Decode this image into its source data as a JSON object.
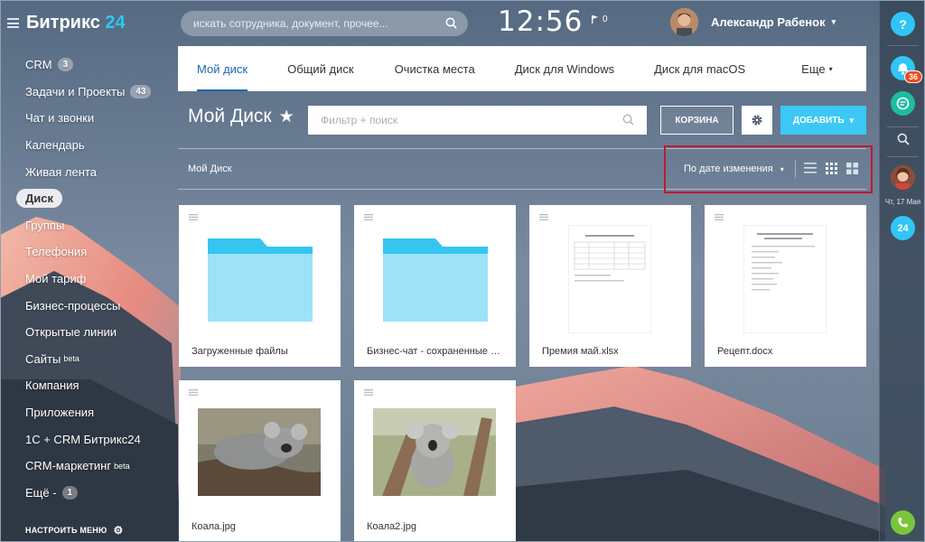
{
  "logo": {
    "text": "Битрикс",
    "number": "24"
  },
  "sidebar": {
    "items": [
      {
        "label": "CRM",
        "counter": "3"
      },
      {
        "label": "Задачи и Проекты",
        "counter": "43"
      },
      {
        "label": "Чат и звонки"
      },
      {
        "label": "Календарь"
      },
      {
        "label": "Живая лента"
      },
      {
        "label": "Диск",
        "active": true
      },
      {
        "label": "Группы"
      },
      {
        "label": "Телефония"
      },
      {
        "label": "Мой тариф"
      },
      {
        "label": "Бизнес-процессы"
      },
      {
        "label": "Открытые линии"
      },
      {
        "label": "Сайты",
        "beta": "beta"
      },
      {
        "label": "Компания"
      },
      {
        "label": "Приложения"
      },
      {
        "label": "1С + CRM Битрикс24"
      },
      {
        "label": "CRM-маркетинг",
        "beta": "beta"
      },
      {
        "label": "Ещё -",
        "counter": "1"
      }
    ],
    "settings_label": "НАСТРОИТЬ МЕНЮ"
  },
  "header": {
    "search_placeholder": "искать сотрудника, документ, прочее...",
    "time": "12:56",
    "flag_count": "0",
    "user_name": "Александр Рабенок"
  },
  "right_panel": {
    "help": "?",
    "notifications_count": "36",
    "date": "Чт, 17 Мая",
    "calendar_day": "24"
  },
  "tabs": [
    {
      "label": "Мой диск",
      "active": true
    },
    {
      "label": "Общий диск"
    },
    {
      "label": "Очистка места"
    },
    {
      "label": "Диск для Windows"
    },
    {
      "label": "Диск для macOS"
    },
    {
      "label": "Еще"
    }
  ],
  "page": {
    "title": "Мой Диск",
    "filter_placeholder": "Фильтр + поиск",
    "cart_label": "КОРЗИНА",
    "add_label": "ДОБАВИТЬ",
    "breadcrumb": "Мой Диск",
    "sort_label": "По дате изменения"
  },
  "files": [
    {
      "name": "Загруженные файлы",
      "type": "folder"
    },
    {
      "name": "Бизнес-чат - сохраненные файлы",
      "type": "folder"
    },
    {
      "name": "Премия май.xlsx",
      "type": "xlsx"
    },
    {
      "name": "Рецепт.docx",
      "type": "docx"
    },
    {
      "name": "Коала.jpg",
      "type": "image"
    },
    {
      "name": "Коала2.jpg",
      "type": "image"
    }
  ],
  "colors": {
    "accent": "#2fc6f6",
    "tab_active": "#2067b0",
    "add_button": "#3bc8f5",
    "highlight": "#c0192f"
  }
}
